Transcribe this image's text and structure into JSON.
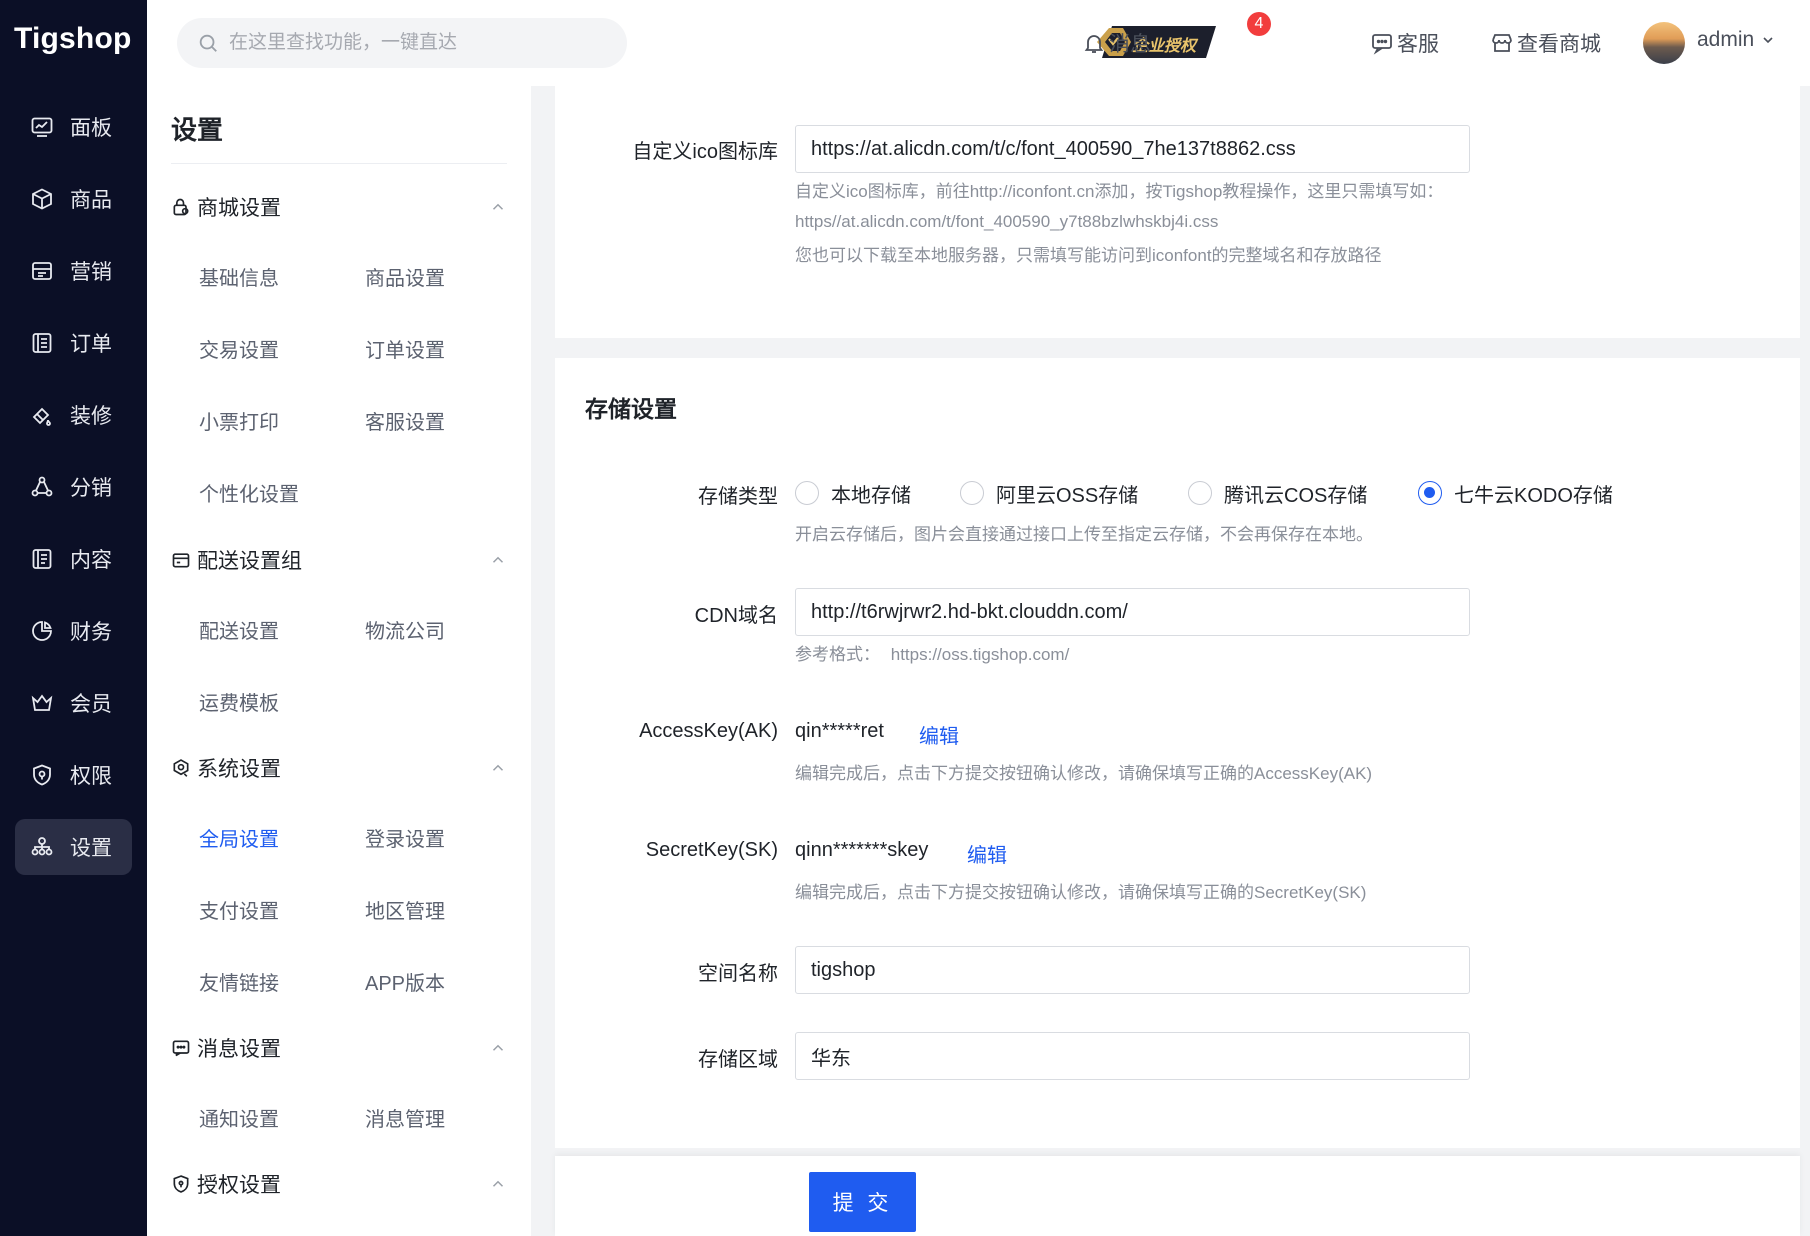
{
  "brand": {
    "logo_text": "Tigshop"
  },
  "left_nav": {
    "items": [
      {
        "label": "面板",
        "icon": "dashboard-icon"
      },
      {
        "label": "商品",
        "icon": "box-icon"
      },
      {
        "label": "营销",
        "icon": "marketing-icon"
      },
      {
        "label": "订单",
        "icon": "order-icon"
      },
      {
        "label": "装修",
        "icon": "paint-icon"
      },
      {
        "label": "分销",
        "icon": "distribution-icon"
      },
      {
        "label": "内容",
        "icon": "content-icon"
      },
      {
        "label": "财务",
        "icon": "finance-icon"
      },
      {
        "label": "会员",
        "icon": "crown-icon"
      },
      {
        "label": "权限",
        "icon": "shield-icon"
      },
      {
        "label": "设置",
        "icon": "settings-icon",
        "active": true
      }
    ]
  },
  "header": {
    "search_placeholder": "在这里查找功能，一键直达",
    "auth_badge_text": "企业授权",
    "message_count": "4",
    "messages_label": "消息",
    "service_label": "客服",
    "view_store_label": "查看商城",
    "username": "admin"
  },
  "subnav": {
    "title": "设置",
    "groups": [
      {
        "title": "商城设置",
        "items": [
          "基础信息",
          "商品设置",
          "交易设置",
          "订单设置",
          "小票打印",
          "客服设置",
          "个性化设置"
        ]
      },
      {
        "title": "配送设置组",
        "items": [
          "配送设置",
          "物流公司",
          "运费模板"
        ]
      },
      {
        "title": "系统设置",
        "items": [
          "全局设置",
          "登录设置",
          "支付设置",
          "地区管理",
          "友情链接",
          "APP版本"
        ],
        "active_item": "全局设置"
      },
      {
        "title": "消息设置",
        "items": [
          "通知设置",
          "消息管理"
        ]
      },
      {
        "title": "授权设置",
        "items": []
      }
    ]
  },
  "icon_section": {
    "label": "自定义ico图标库",
    "value": "https://at.alicdn.com/t/c/font_400590_7he137t8862.css",
    "hint_lines": [
      "自定义ico图标库，前往http://iconfont.cn添加，按Tigshop教程操作，这里只需填写如：",
      "https//at.alicdn.com/t/font_400590_y7t88bzlwhskbj4i.css",
      "您也可以下载至本地服务器，只需填写能访问到iconfont的完整域名和存放路径"
    ]
  },
  "storage": {
    "section_title": "存储设置",
    "type_label": "存储类型",
    "options": [
      "本地存储",
      "阿里云OSS存储",
      "腾讯云COS存储",
      "七牛云KODO存储"
    ],
    "selected": "七牛云KODO存储",
    "type_hint": "开启云存储后，图片会直接通过接口上传至指定云存储，不会再保存在本地。",
    "cdn_label": "CDN域名",
    "cdn_value": "http://t6rwjrwr2.hd-bkt.clouddn.com/",
    "cdn_hint_prefix": "参考格式：",
    "cdn_hint_example": "https://oss.tigshop.com/",
    "ak_label": "AccessKey(AK)",
    "ak_value": "qin*****ret",
    "ak_edit": "编辑",
    "ak_hint": "编辑完成后，点击下方提交按钮确认修改，请确保填写正确的AccessKey(AK)",
    "sk_label": "SecretKey(SK)",
    "sk_value": "qinn*******skey",
    "sk_edit": "编辑",
    "sk_hint": "编辑完成后，点击下方提交按钮确认修改，请确保填写正确的SecretKey(SK)",
    "bucket_label": "空间名称",
    "bucket_value": "tigshop",
    "region_label": "存储区域",
    "region_value": "华东"
  },
  "footer": {
    "submit_label": "提 交"
  },
  "colors": {
    "primary": "#1f5cf0",
    "nav_bg": "#0b0f26",
    "badge": "#f23d3d"
  }
}
